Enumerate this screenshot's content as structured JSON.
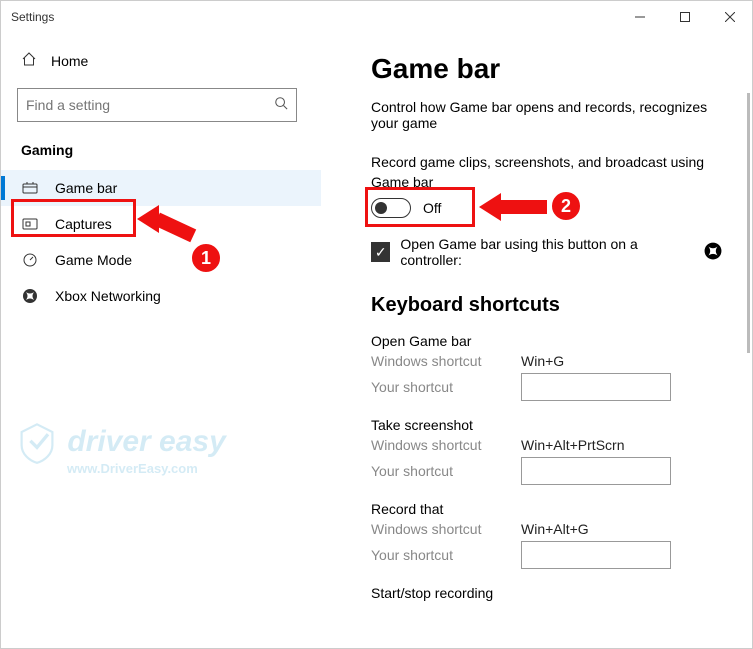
{
  "window": {
    "title": "Settings"
  },
  "sidebar": {
    "home": "Home",
    "search_placeholder": "Find a setting",
    "section": "Gaming",
    "items": [
      {
        "label": "Game bar"
      },
      {
        "label": "Captures"
      },
      {
        "label": "Game Mode"
      },
      {
        "label": "Xbox Networking"
      }
    ]
  },
  "page": {
    "heading": "Game bar",
    "description": "Control how Game bar opens and records, recognizes your game",
    "toggle_description": "Record game clips, screenshots, and broadcast using Game bar",
    "toggle_state": "Off",
    "checkbox_label": "Open Game bar using this button on a controller:",
    "shortcuts_heading": "Keyboard shortcuts",
    "sg": [
      {
        "title": "Open Game bar",
        "win_label": "Windows shortcut",
        "win_value": "Win+G",
        "your_label": "Your shortcut"
      },
      {
        "title": "Take screenshot",
        "win_label": "Windows shortcut",
        "win_value": "Win+Alt+PrtScrn",
        "your_label": "Your shortcut"
      },
      {
        "title": "Record that",
        "win_label": "Windows shortcut",
        "win_value": "Win+Alt+G",
        "your_label": "Your shortcut"
      },
      {
        "title": "Start/stop recording"
      }
    ]
  },
  "annotations": {
    "badge1": "1",
    "badge2": "2"
  },
  "watermark": {
    "brand": "driver easy",
    "url": "www.DriverEasy.com"
  }
}
